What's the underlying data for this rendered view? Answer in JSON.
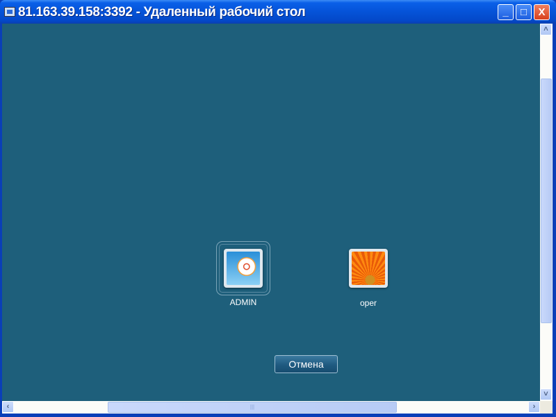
{
  "window": {
    "title": "81.163.39.158:3392 - Удаленный рабочий стол",
    "minimize": "_",
    "maximize": "□",
    "close": "X"
  },
  "users": [
    {
      "name": "ADMIN",
      "picture": "ferris-wheel",
      "selected": true
    },
    {
      "name": "oper",
      "picture": "orange-flower",
      "selected": false
    }
  ],
  "cancel_label": "Отмена",
  "scrollbars": {
    "up": "˄",
    "down": "˅",
    "left": "‹",
    "right": "›",
    "grip": "|||"
  }
}
